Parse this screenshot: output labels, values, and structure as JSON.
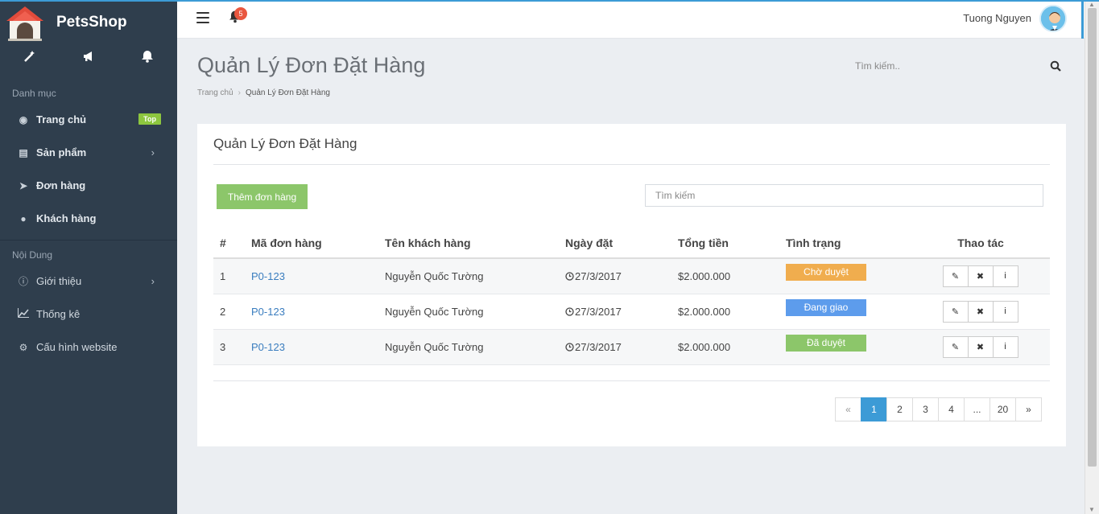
{
  "brand": {
    "name": "PetsShop"
  },
  "quick_icons": [
    "magic-wand-icon",
    "megaphone-icon",
    "bell-icon"
  ],
  "sidebar": {
    "section1_title": "Danh mục",
    "items1": [
      {
        "label": "Trang chủ",
        "icon": "dashboard-icon",
        "badge": "Top"
      },
      {
        "label": "Sản phẩm",
        "icon": "product-icon",
        "chevron": "›"
      },
      {
        "label": "Đơn hàng",
        "icon": "send-icon"
      },
      {
        "label": "Khách hàng",
        "icon": "user-icon"
      }
    ],
    "section2_title": "Nội Dung",
    "items2": [
      {
        "label": "Giới thiệu",
        "icon": "info-icon",
        "chevron": "›"
      },
      {
        "label": "Thống kê",
        "icon": "chart-icon"
      },
      {
        "label": "Cấu hình website",
        "icon": "gears-icon"
      }
    ]
  },
  "topbar": {
    "notification_count": "5",
    "user_name": "Tuong Nguyen"
  },
  "header": {
    "title": "Quản Lý Đơn Đặt Hàng",
    "breadcrumb": [
      "Trang chủ",
      "Quản Lý Đơn Đặt Hàng"
    ],
    "search_placeholder": "Tìm kiếm.."
  },
  "panel": {
    "title": "Quản Lý Đơn Đặt Hàng",
    "add_button": "Thêm đơn hàng",
    "search_placeholder": "Tìm kiếm",
    "columns": [
      "#",
      "Mã đơn hàng",
      "Tên khách hàng",
      "Ngày đặt",
      "Tổng tiền",
      "Tình trạng",
      "Thao tác"
    ],
    "rows": [
      {
        "num": "1",
        "code": "P0-123",
        "customer": "Nguyễn Quốc Tường",
        "date": "27/3/2017",
        "total": "$2.000.000",
        "status": "Chờ duyệt",
        "status_color": "#f0ad4e"
      },
      {
        "num": "2",
        "code": "P0-123",
        "customer": "Nguyễn Quốc Tường",
        "date": "27/3/2017",
        "total": "$2.000.000",
        "status": "Đang giao",
        "status_color": "#5d9cec"
      },
      {
        "num": "3",
        "code": "P0-123",
        "customer": "Nguyễn Quốc Tường",
        "date": "27/3/2017",
        "total": "$2.000.000",
        "status": "Đã duyệt",
        "status_color": "#8cc66a"
      }
    ],
    "actions": [
      "✎",
      "✖",
      "i"
    ]
  },
  "pagination": {
    "prev": "«",
    "pages": [
      "1",
      "2",
      "3",
      "4",
      "...",
      "20"
    ],
    "active": "1",
    "next": "»"
  }
}
